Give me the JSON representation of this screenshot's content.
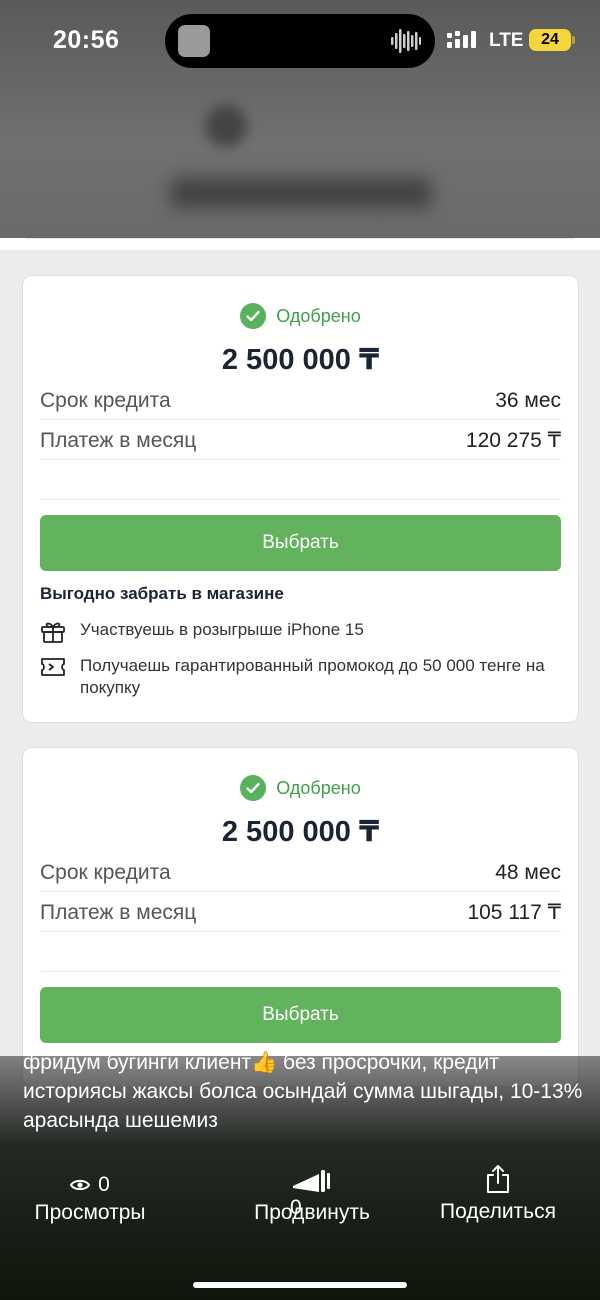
{
  "status_bar": {
    "time": "20:56",
    "network": "LTE",
    "battery": "24"
  },
  "offers": [
    {
      "status": "Одобрено",
      "amount": "2 500 000 ₸",
      "term_label": "Срок кредита",
      "term_value": "36 мес",
      "payment_label": "Платеж в месяц",
      "payment_value": "120 275 ₸",
      "button": "Выбрать",
      "promo_title": "Выгодно забрать в магазине",
      "perks": [
        {
          "icon": "gift-icon",
          "text": "Участвуешь в розыгрыше iPhone 15"
        },
        {
          "icon": "ticket-icon",
          "text": "Получаешь гарантированный промокод до 50 000 тенге на покупку"
        }
      ]
    },
    {
      "status": "Одобрено",
      "amount": "2 500 000 ₸",
      "term_label": "Срок кредита",
      "term_value": "48 мес",
      "payment_label": "Платеж в месяц",
      "payment_value": "105 117 ₸",
      "button": "Выбрать"
    }
  ],
  "post": {
    "caption": "фридум бугинги клиент👍 без просрочки, кредит историясы жаксы болса осындай сумма шыгады, 10-13% арасында шешемиз",
    "views_count": "0",
    "views_label": "Просмотры",
    "promote_count": "0",
    "promote_label": "Продвинуть",
    "share_label": "Поделиться"
  },
  "colors": {
    "accent_green": "#62b25e",
    "approved_green": "#3f9e4b",
    "battery_yellow": "#f4d63a"
  }
}
